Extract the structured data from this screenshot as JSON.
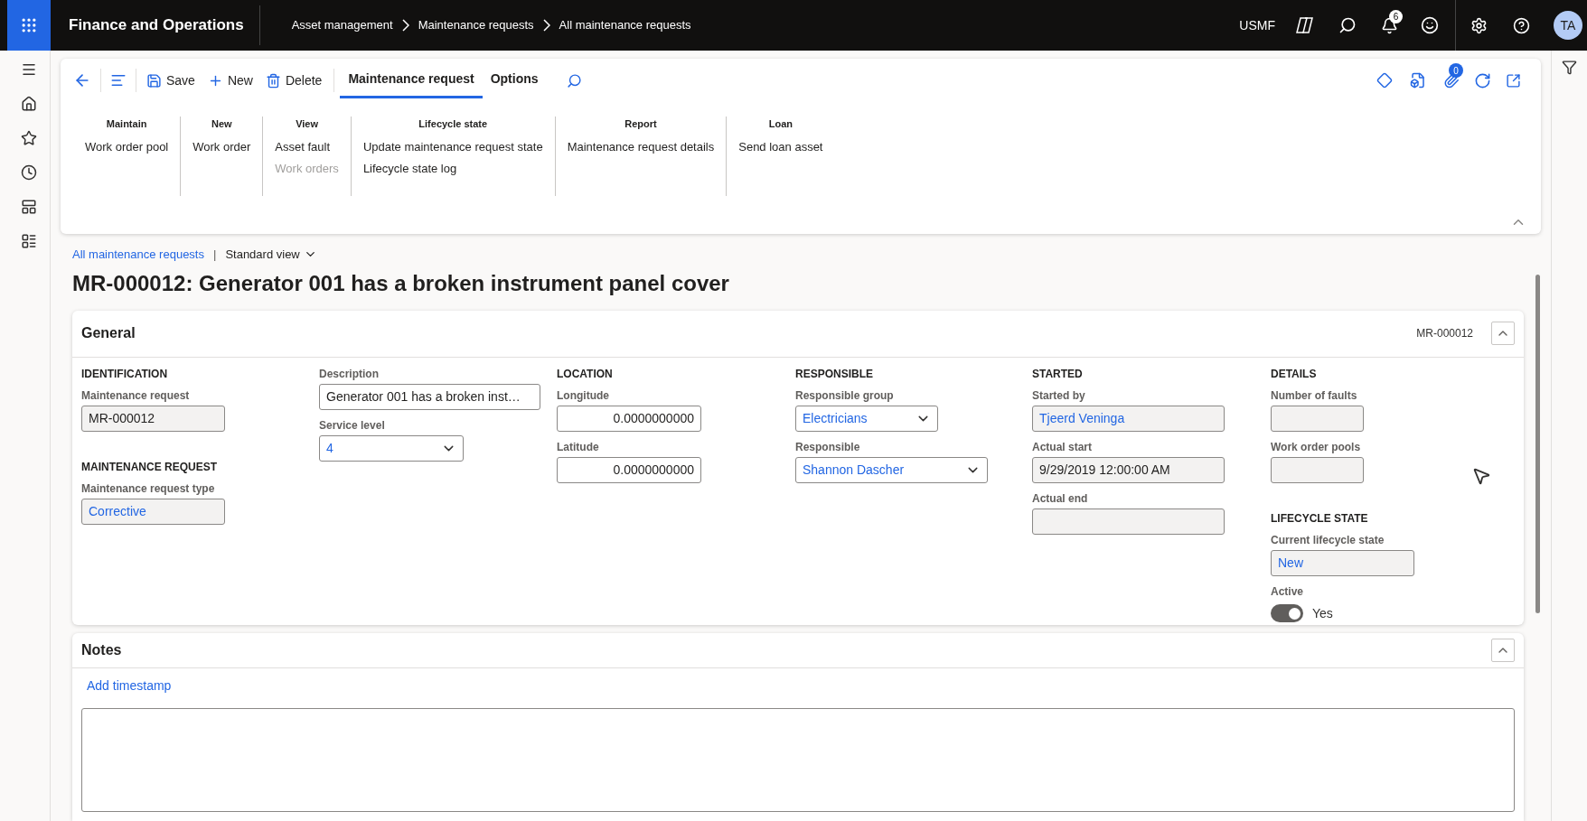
{
  "app": {
    "title": "Finance and Operations",
    "breadcrumb": [
      "Asset management",
      "Maintenance requests",
      "All maintenance requests"
    ],
    "company": "USMF",
    "notification_count": "6",
    "avatar": "TA"
  },
  "toolbar": {
    "buttons": [
      {
        "label": "Save",
        "kind": "save"
      },
      {
        "label": "New",
        "kind": "new"
      },
      {
        "label": "Delete",
        "kind": "delete"
      }
    ],
    "tabs": [
      {
        "label": "Maintenance request",
        "selected": true
      },
      {
        "label": "Options",
        "selected": false
      }
    ],
    "attachment_count": "0"
  },
  "ribbon": {
    "expanded": true,
    "groups": [
      {
        "title": "Maintain",
        "items": [
          {
            "label": "Work order pool",
            "disabled": false
          }
        ]
      },
      {
        "title": "New",
        "items": [
          {
            "label": "Work order",
            "disabled": false
          }
        ]
      },
      {
        "title": "View",
        "items": [
          {
            "label": "Asset fault",
            "disabled": false
          },
          {
            "label": "Work orders",
            "disabled": true
          }
        ]
      },
      {
        "title": "Lifecycle state",
        "items": [
          {
            "label": "Update maintenance request state",
            "disabled": false
          },
          {
            "label": "Lifecycle state log",
            "disabled": false
          }
        ]
      },
      {
        "title": "Report",
        "items": [
          {
            "label": "Maintenance request details",
            "disabled": false
          }
        ]
      },
      {
        "title": "Loan",
        "items": [
          {
            "label": "Send loan asset",
            "disabled": false
          }
        ]
      }
    ]
  },
  "page": {
    "list_link": "All maintenance requests",
    "separator": "|",
    "view": "Standard view",
    "title": "MR-000012: Generator 001 has a broken instrument panel cover"
  },
  "general": {
    "title": "General",
    "summary": "MR-000012",
    "expanded": true,
    "columns": [
      {
        "sections": [
          {
            "heading": "IDENTIFICATION",
            "fields": [
              {
                "label": "Maintenance request",
                "value": "MR-000012",
                "kind": "text",
                "readonly": true,
                "link": false
              }
            ]
          },
          {
            "heading": "MAINTENANCE REQUEST",
            "fields": [
              {
                "label": "Maintenance request type",
                "value": "Corrective",
                "kind": "text",
                "readonly": true,
                "link": true
              }
            ]
          }
        ]
      },
      {
        "sections": [
          {
            "fields": [
              {
                "label": "Description",
                "value": "Generator 001 has a broken inst…",
                "kind": "text",
                "readonly": false,
                "link": false
              },
              {
                "label": "Service level",
                "value": "4",
                "kind": "dropdown",
                "readonly": false,
                "link": true
              }
            ]
          }
        ]
      },
      {
        "sections": [
          {
            "heading": "LOCATION",
            "fields": [
              {
                "label": "Longitude",
                "value": "0.0000000000",
                "kind": "number",
                "readonly": false,
                "link": false
              },
              {
                "label": "Latitude",
                "value": "0.0000000000",
                "kind": "number",
                "readonly": false,
                "link": false
              }
            ]
          }
        ]
      },
      {
        "sections": [
          {
            "heading": "RESPONSIBLE",
            "fields": [
              {
                "label": "Responsible group",
                "value": "Electricians",
                "kind": "dropdown",
                "readonly": false,
                "link": true
              },
              {
                "label": "Responsible",
                "value": "Shannon Dascher",
                "kind": "dropdown",
                "readonly": false,
                "link": true
              }
            ]
          }
        ]
      },
      {
        "sections": [
          {
            "heading": "STARTED",
            "fields": [
              {
                "label": "Started by",
                "value": "Tjeerd Veninga",
                "kind": "text",
                "readonly": true,
                "link": true
              },
              {
                "label": "Actual start",
                "value": "9/29/2019 12:00:00 AM",
                "kind": "text",
                "readonly": true,
                "link": false
              },
              {
                "label": "Actual end",
                "kind": "text",
                "readonly": true
              }
            ]
          }
        ]
      },
      {
        "sections": [
          {
            "heading": "DETAILS",
            "fields": [
              {
                "label": "Number of faults",
                "kind": "text",
                "readonly": true
              },
              {
                "label": "Work order pools",
                "kind": "text",
                "readonly": true
              }
            ]
          },
          {
            "heading": "LIFECYCLE STATE",
            "fields": [
              {
                "label": "Current lifecycle state",
                "value": "New",
                "kind": "text",
                "readonly": true,
                "link": true
              },
              {
                "label": "Active",
                "value": "Yes",
                "kind": "toggle",
                "on": true
              }
            ]
          }
        ]
      }
    ]
  },
  "notes": {
    "title": "Notes",
    "expanded": true,
    "action": "Add timestamp"
  }
}
